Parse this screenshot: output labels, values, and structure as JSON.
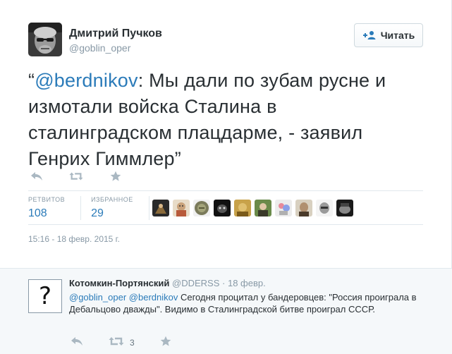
{
  "tweet": {
    "author_name": "Дмитрий Пучков",
    "author_handle": "@goblin_oper",
    "follow_label": "Читать",
    "text_open_quote": "“",
    "text_mention": "@berdnikov",
    "text_body": ": Мы дали по зубам русне и измотали войска Сталина в сталинградском плацдарме, - заявил Генрих Гиммлер",
    "text_close_quote": "”",
    "actions": [
      "reply-icon",
      "retweet-icon",
      "favorite-icon"
    ],
    "stats": [
      {
        "label": "РЕТВИТОВ",
        "value": "108"
      },
      {
        "label": "ИЗБРАННОЕ",
        "value": "29"
      }
    ],
    "favoriters_count": 10,
    "timestamp": "15:16 - 18 февр. 2015 г."
  },
  "reply": {
    "avatar_glyph": "?",
    "author_name": "Котомкин-Портянский",
    "author_handle": "@DDERSS",
    "separator": "·",
    "date": "18 февр.",
    "mention_1": "@goblin_oper",
    "mention_2": "@berdnikov",
    "text": "Сегодня процитал у бандеровцев: \"Россия проиграла в Дебальцово дважды\". Видимо в Сталинградской битве проиграл СССР.",
    "retweet_count": "3"
  },
  "colors": {
    "link": "#2b7bb9",
    "muted": "#8899a6",
    "text": "#292f33",
    "icon": "#aab8c2",
    "reply_bg": "#f5f8fa"
  }
}
